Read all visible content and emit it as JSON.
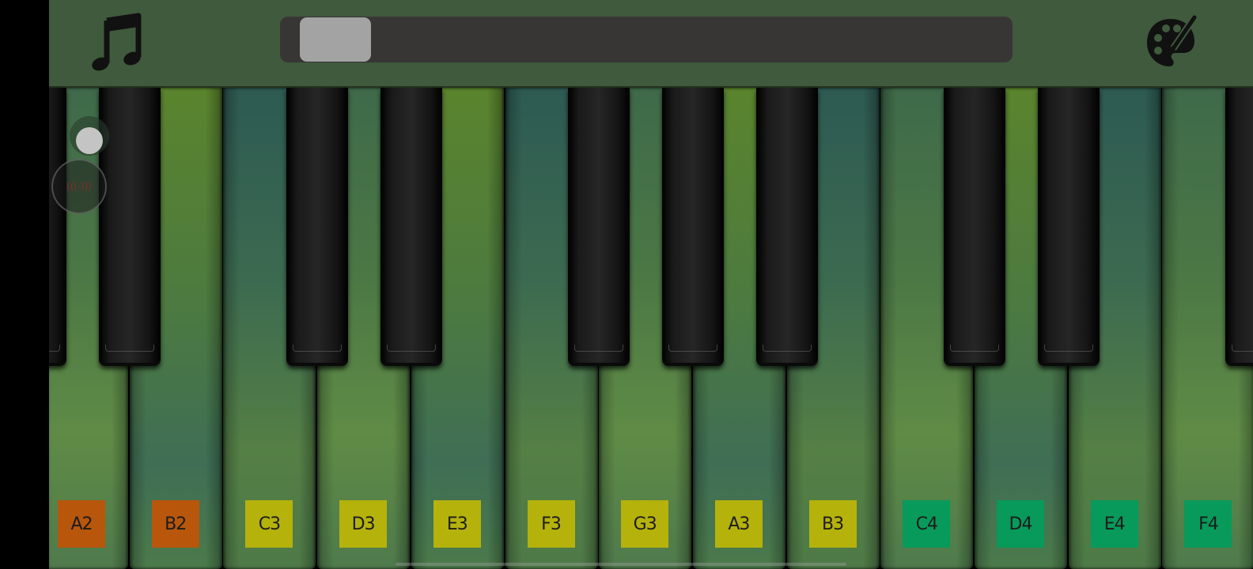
{
  "toolbar": {
    "music_icon": "music-note-icon",
    "palette_icon": "palette-brush-icon",
    "keyboard_scroll_position": 0.03
  },
  "side_controls": {
    "record_label": "(((·)))"
  },
  "keyboard": {
    "white_keys": [
      {
        "note": "A2",
        "label_color": "#b8560c"
      },
      {
        "note": "B2",
        "label_color": "#b8560c"
      },
      {
        "note": "C3",
        "label_color": "#b5b20c"
      },
      {
        "note": "D3",
        "label_color": "#b5b20c"
      },
      {
        "note": "E3",
        "label_color": "#b5b20c"
      },
      {
        "note": "F3",
        "label_color": "#b5b20c"
      },
      {
        "note": "G3",
        "label_color": "#b5b20c"
      },
      {
        "note": "A3",
        "label_color": "#b5b20c"
      },
      {
        "note": "B3",
        "label_color": "#b5b20c"
      },
      {
        "note": "C4",
        "label_color": "#089a5a"
      },
      {
        "note": "D4",
        "label_color": "#089a5a"
      },
      {
        "note": "E4",
        "label_color": "#089a5a"
      },
      {
        "note": "F4",
        "label_color": "#089a5a"
      }
    ]
  },
  "colors": {
    "toolbar_bg": "#3f5a3c",
    "scroll_track": "#383634",
    "scroll_thumb": "#a3a3a3"
  }
}
